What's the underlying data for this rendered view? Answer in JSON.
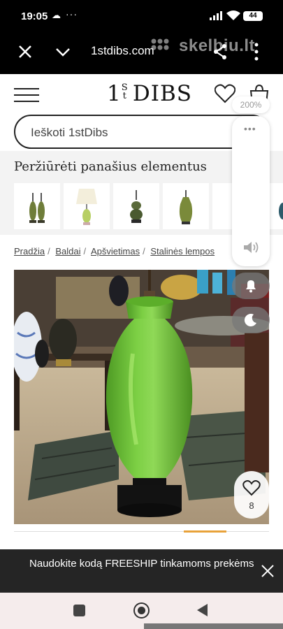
{
  "status_bar": {
    "time": "19:05",
    "battery": "44"
  },
  "browser": {
    "url": "1stdibs.com",
    "watermark": "skelbiu.lt"
  },
  "header": {
    "logo_main": "1",
    "logo_sup_top": "S",
    "logo_sup_bottom": "t",
    "logo_rest": "DIBS"
  },
  "search": {
    "placeholder": "Ieškoti 1stDibs"
  },
  "similar": {
    "title": "Peržiūrėti panašius elementus",
    "items": [
      "lamp-pair-green",
      "lamp-white-shade",
      "lamp-dark-bronze",
      "lamp-green-vase",
      "lamp-partial",
      "lamp-partial-blue"
    ]
  },
  "breadcrumbs": [
    "Pradžia",
    "Baldai",
    "Apšvietimas",
    "Stalinės lempos"
  ],
  "favorite": {
    "count": "8"
  },
  "zoom": "200%",
  "promo": {
    "text": "Naudokite kodą FREESHIP tinkamoms prekėms"
  },
  "colors": {
    "lamp_green": "#6fbf3a",
    "accent_orange": "#e8a23a",
    "dark": "#222222"
  }
}
